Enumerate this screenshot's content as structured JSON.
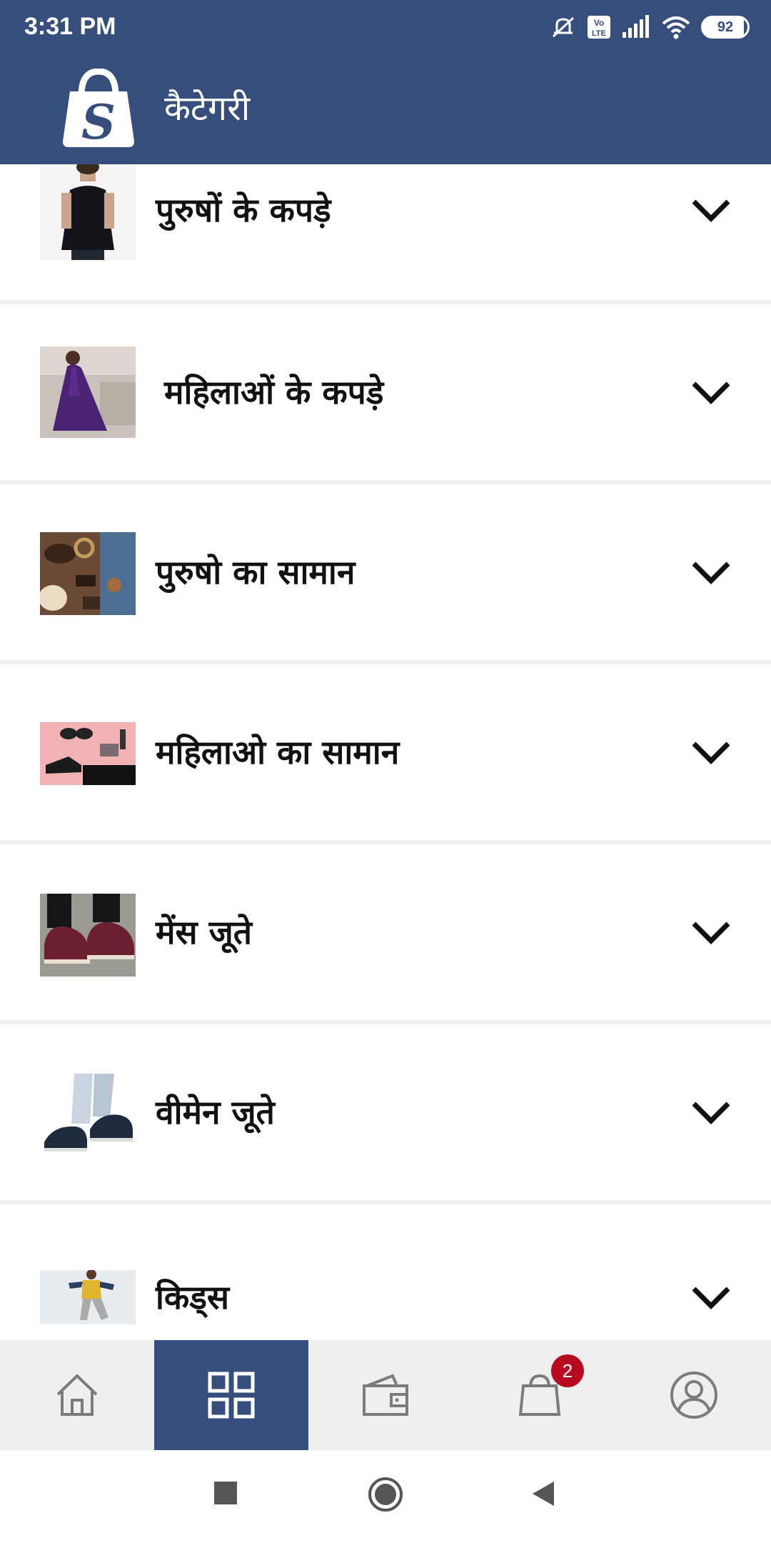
{
  "status_bar": {
    "time": "3:31 PM",
    "battery": "92",
    "icons": [
      "mute-vibrate-icon",
      "volte-icon",
      "signal-icon",
      "wifi-icon",
      "battery-icon"
    ]
  },
  "app_bar": {
    "title": "कैटेगरी",
    "logo_letter": "S"
  },
  "categories": [
    {
      "label": "पुरुषों के कपड़े",
      "thumbnail": "men-clothing-photo"
    },
    {
      "label": "महिलाओं के कपड़े",
      "thumbnail": "women-dress-photo"
    },
    {
      "label": "पुरुषो का सामान",
      "thumbnail": "men-accessories-photo"
    },
    {
      "label": "महिलाओ का सामान",
      "thumbnail": "women-accessories-photo"
    },
    {
      "label": "मेंस जूते",
      "thumbnail": "men-shoes-photo"
    },
    {
      "label": "वीमेन जूते",
      "thumbnail": "women-shoes-photo"
    },
    {
      "label": "किड्स",
      "thumbnail": "kids-photo"
    }
  ],
  "bottom_nav": {
    "items": [
      "home-icon",
      "categories-icon",
      "wallet-icon",
      "shopping-bag-icon",
      "profile-icon"
    ],
    "active_index": 1,
    "cart_badge": "2"
  },
  "colors": {
    "primary": "#364e7c",
    "badge": "#b80b1f",
    "nav_background": "#efefef",
    "divider": "#eeeeee"
  }
}
